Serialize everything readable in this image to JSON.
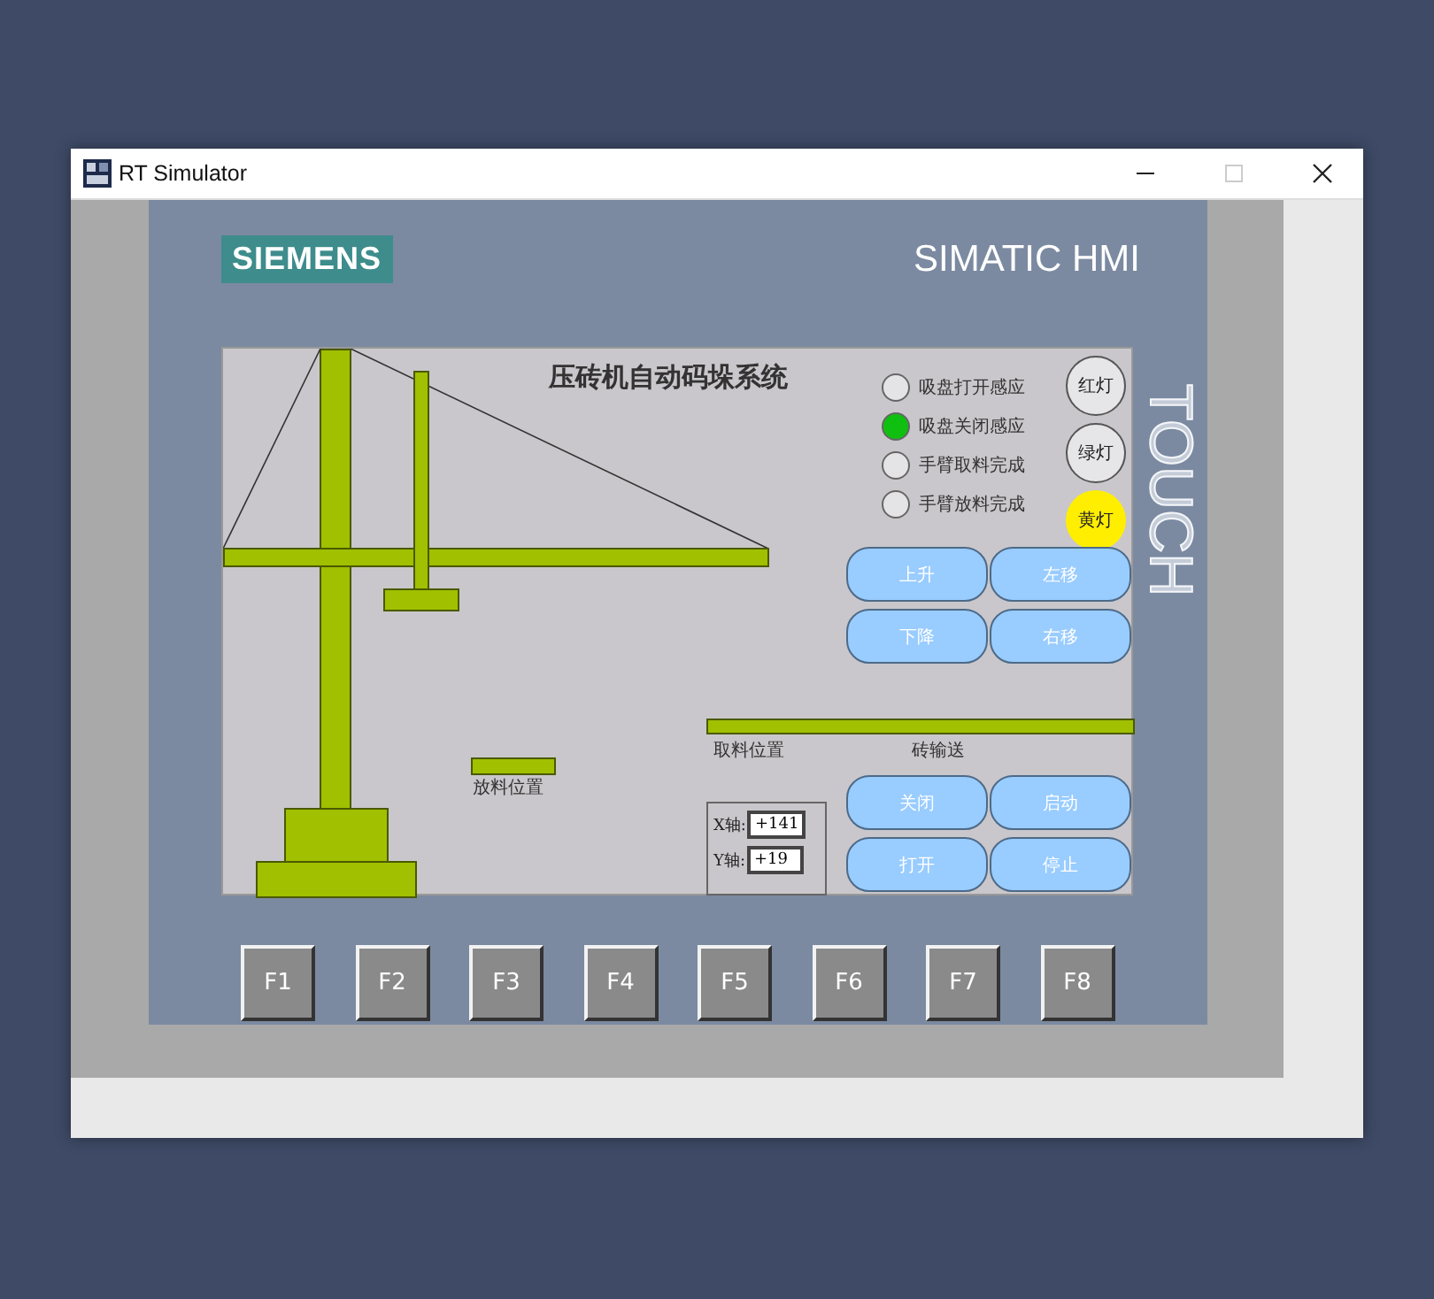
{
  "window": {
    "title": "RT Simulator"
  },
  "hmi": {
    "brand": "SIEMENS",
    "product": "SIMATIC HMI",
    "side_label": "TOUCH",
    "screen": {
      "title": "压砖机自动码垛系统",
      "indicators": [
        {
          "label": "吸盘打开感应",
          "on": false
        },
        {
          "label": "吸盘关闭感应",
          "on": true
        },
        {
          "label": "手臂取料完成",
          "on": false
        },
        {
          "label": "手臂放料完成",
          "on": false
        }
      ],
      "lights": [
        {
          "label": "红灯",
          "on": false
        },
        {
          "label": "绿灯",
          "on": false
        },
        {
          "label": "黄灯",
          "on": true,
          "color": "#ffee00"
        }
      ],
      "motion_buttons": [
        "上升",
        "左移",
        "下降",
        "右移"
      ],
      "drop_label": "放料位置",
      "pick_label": "取料位置",
      "conveyor_label": "砖输送",
      "coords": [
        {
          "label": "X轴:",
          "value": "+141"
        },
        {
          "label": "Y轴:",
          "value": "+19"
        }
      ],
      "control_buttons": [
        "关闭",
        "启动",
        "打开",
        "停止"
      ]
    },
    "function_keys": [
      "F1",
      "F2",
      "F3",
      "F4",
      "F5",
      "F6",
      "F7",
      "F8"
    ]
  }
}
